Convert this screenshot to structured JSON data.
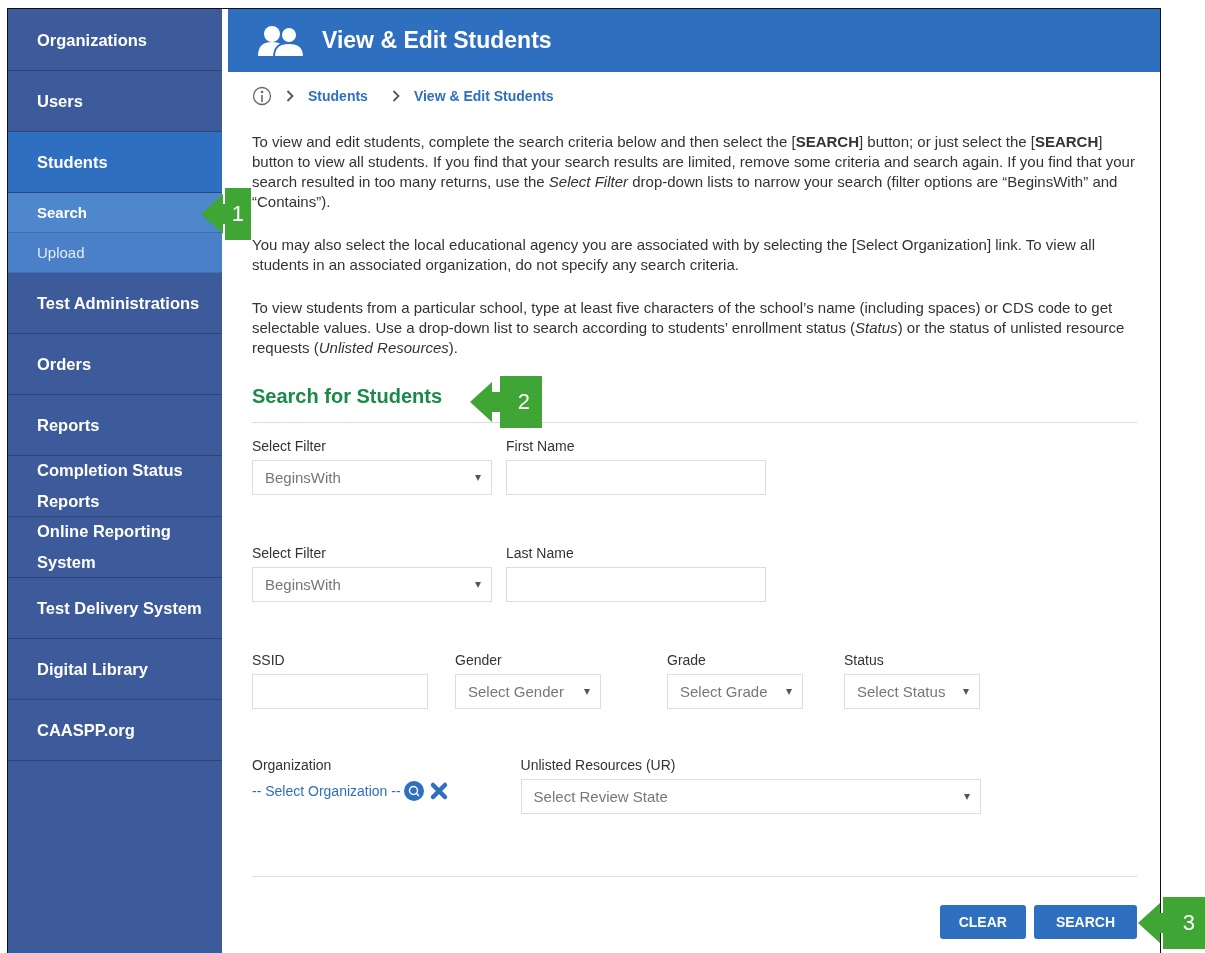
{
  "sidebar": {
    "items": [
      {
        "label": "Organizations",
        "kind": "main",
        "selected": false
      },
      {
        "label": "Users",
        "kind": "main",
        "selected": false
      },
      {
        "label": "Students",
        "kind": "main",
        "selected": true
      },
      {
        "label": "Search",
        "kind": "sub",
        "selected": true
      },
      {
        "label": "Upload",
        "kind": "sub",
        "selected": false
      },
      {
        "label": "Test Administrations",
        "kind": "main",
        "selected": false
      },
      {
        "label": "Orders",
        "kind": "main",
        "selected": false
      },
      {
        "label": "Reports",
        "kind": "main",
        "selected": false
      },
      {
        "label": "Completion Status Reports",
        "kind": "main",
        "selected": false
      },
      {
        "label": "Online Reporting System",
        "kind": "main",
        "selected": false
      },
      {
        "label": "Test Delivery System",
        "kind": "main",
        "selected": false
      },
      {
        "label": "Digital Library",
        "kind": "main",
        "selected": false
      },
      {
        "label": "CAASPP.org",
        "kind": "main",
        "selected": false
      }
    ]
  },
  "header": {
    "title": "View & Edit Students"
  },
  "breadcrumb": [
    "Students",
    "View & Edit Students"
  ],
  "paragraphs": [
    "To view and edit students, complete the search criteria below and then select the [**SEARCH**] button; or just select the [**SEARCH**] button to view all students. If you find that your search results are limited, remove some criteria and search again. If you find that your search resulted in too many returns, use the *Select Filter* drop-down lists to narrow your search (filter options are “BeginsWith” and “Contains”).",
    "You may also select the local educational agency you are associated with by selecting the [Select Organization] link. To view all students in an associated organization, do not specify any search criteria.",
    "To view students from a particular school, type at least five characters of the school’s name (including spaces) or CDS code to get selectable values. Use a drop-down list to search according to students’ enrollment status (*Status*) or the status of unlisted resource requests (*Unlisted Resources*)."
  ],
  "search_form": {
    "title": "Search for Students",
    "rows": [
      [
        {
          "label": "Select Filter",
          "kind": "select",
          "value": "BeginsWith"
        },
        {
          "label": "First Name",
          "kind": "text"
        }
      ],
      [
        {
          "label": "Select Filter",
          "kind": "select",
          "value": "BeginsWith"
        },
        {
          "label": "Last Name",
          "kind": "text"
        }
      ],
      [
        {
          "label": "SSID",
          "kind": "text"
        },
        {
          "label": "Gender",
          "kind": "select",
          "value": "Select Gender"
        },
        {
          "label": "Grade",
          "kind": "select",
          "value": "Select Grade"
        },
        {
          "label": "Status",
          "kind": "select",
          "value": "Select Status"
        }
      ],
      [
        {
          "label": "Organization",
          "kind": "link",
          "value": "-- Select Organization --"
        },
        {
          "label": "Unlisted Resources (UR)",
          "kind": "select",
          "value": "Select Review State"
        }
      ]
    ]
  },
  "buttons": [
    "CLEAR",
    "SEARCH"
  ],
  "callouts": [
    "1",
    "2",
    "3"
  ]
}
